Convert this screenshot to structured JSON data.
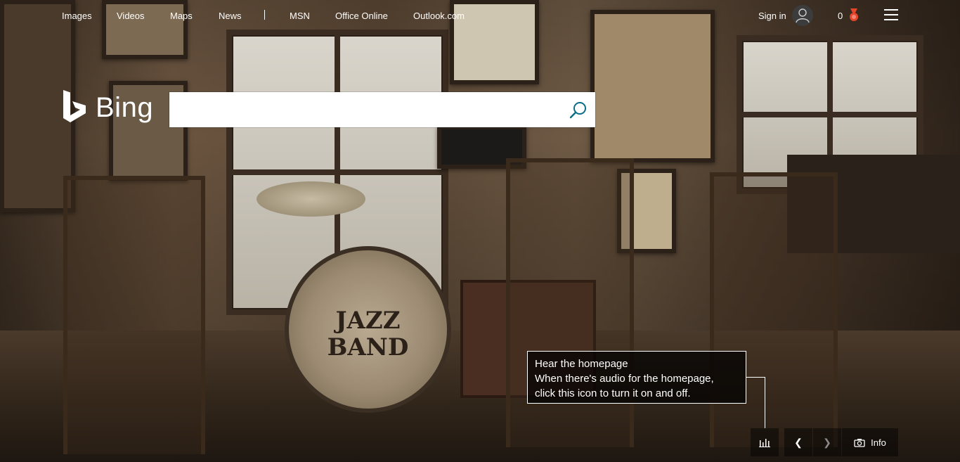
{
  "nav": {
    "links": [
      "Images",
      "Videos",
      "Maps",
      "News",
      "MSN",
      "Office Online",
      "Outlook.com"
    ]
  },
  "account": {
    "sign_in": "Sign in",
    "rewards_count": "0",
    "rewards_color": "#e8462b"
  },
  "logo": {
    "text": "Bing"
  },
  "search": {
    "value": "",
    "placeholder": ""
  },
  "tooltip": {
    "title": "Hear the homepage",
    "body_line1": "When there's audio for the homepage,",
    "body_line2": "click this icon to turn it on and off."
  },
  "controls": {
    "info_label": "Info",
    "prev_icon": "chevron-left-icon",
    "next_icon": "chevron-right-icon"
  },
  "colors": {
    "search_icon": "#0c6e86"
  }
}
